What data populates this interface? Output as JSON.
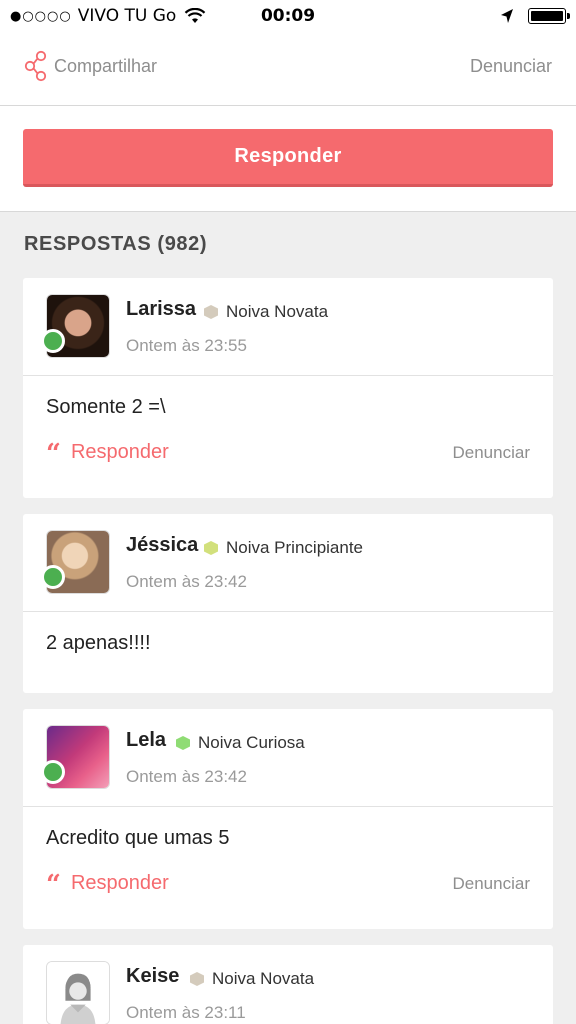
{
  "status_bar": {
    "signal_dots": "●○○○○",
    "carrier": "VIVO TU Go",
    "time": "00:09"
  },
  "toolbar": {
    "share_label": "Compartilhar",
    "report_label": "Denunciar"
  },
  "respond_button": {
    "label": "Responder"
  },
  "responses": {
    "title": "RESPOSTAS (982)",
    "items": [
      {
        "name": "Larissa",
        "rank": "Noiva Novata",
        "rank_color": "#d4cbbc",
        "time": "Ontem às 23:55",
        "message": "Somente 2 =\\",
        "reply_label": "Responder",
        "report_label": "Denunciar"
      },
      {
        "name": "Jéssica",
        "rank": "Noiva Principiante",
        "rank_color": "#d2e07c",
        "time": "Ontem às 23:42",
        "message": "2 apenas!!!!"
      },
      {
        "name": "Lela",
        "rank": "Noiva Curiosa",
        "rank_color": "#8fdc74",
        "time": "Ontem às 23:42",
        "message": "Acredito que umas 5",
        "reply_label": "Responder",
        "report_label": "Denunciar"
      },
      {
        "name": "Keise",
        "rank": "Noiva Novata",
        "rank_color": "#d4cbbc",
        "time": "Ontem às 23:11"
      }
    ]
  },
  "colors": {
    "accent": "#f56a6e",
    "online": "#4caf50"
  }
}
